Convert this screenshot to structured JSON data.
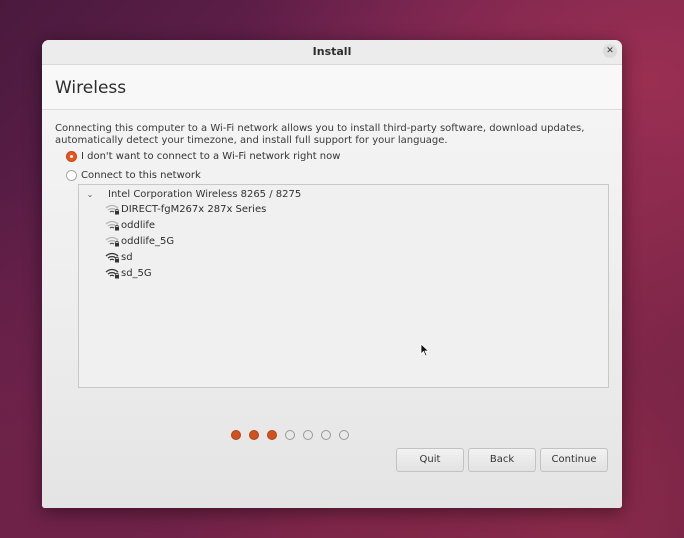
{
  "window": {
    "title": "Install",
    "close_glyph": "✕"
  },
  "page": {
    "title": "Wireless",
    "description": "Connecting this computer to a Wi-Fi network allows you to install third-party software, download updates, automatically detect your timezone, and install full support for your language."
  },
  "options": {
    "no_connect_label": "I don't want to connect to a Wi-Fi network right now",
    "connect_label": "Connect to this network",
    "selected": "no_connect"
  },
  "network_list": {
    "adapter": "Intel Corporation Wireless 8265 / 8275",
    "expanded": true,
    "networks": [
      {
        "ssid": "DIRECT-fgM267x 287x Series",
        "icon": "wifi-lock-weak-icon"
      },
      {
        "ssid": "oddlife",
        "icon": "wifi-lock-weak-icon"
      },
      {
        "ssid": "oddlife_5G",
        "icon": "wifi-lock-weak-icon"
      },
      {
        "ssid": "sd",
        "icon": "wifi-lock-strong-icon"
      },
      {
        "ssid": "sd_5G",
        "icon": "wifi-lock-strong-icon"
      }
    ]
  },
  "buttons": {
    "quit": "Quit",
    "back": "Back",
    "continue": "Continue"
  },
  "progress": {
    "total_steps": 7,
    "completed_steps": 3,
    "accent_color": "#d2521e"
  }
}
